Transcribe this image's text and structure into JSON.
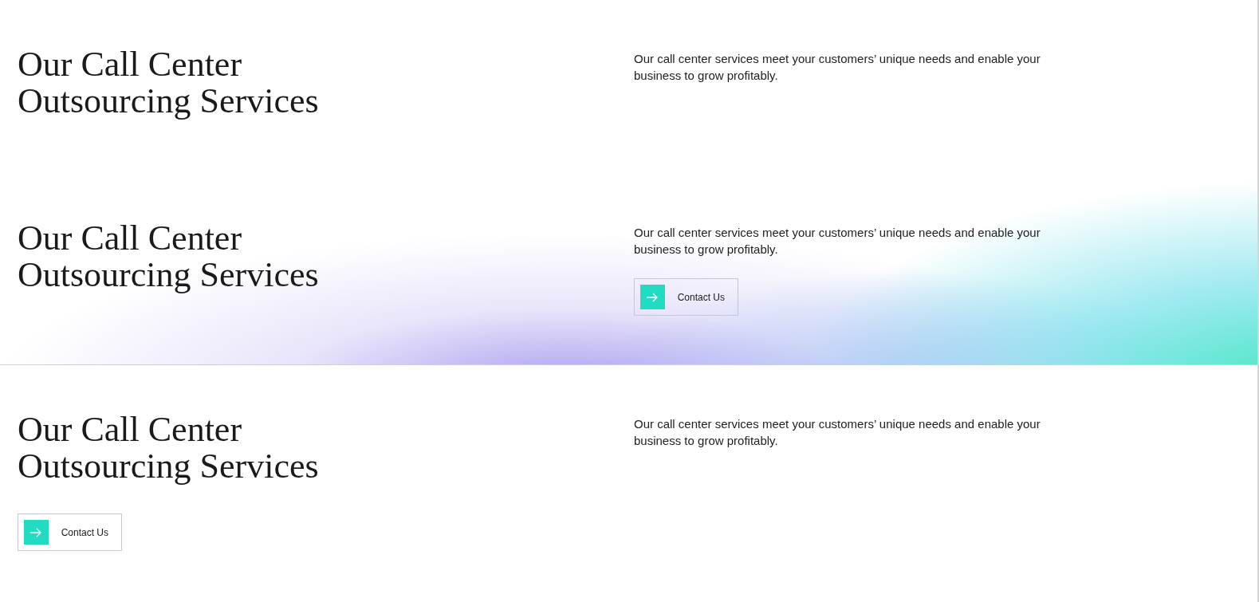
{
  "sections": [
    {
      "kind": "plain",
      "heading": "Our Call Center Outsourcing Services",
      "text": "Our call center services meet your customers’ unique needs and enable your business to grow profitably."
    },
    {
      "kind": "gradient",
      "heading": "Our Call Center Outsourcing Services",
      "text": "Our call center services meet your customers’ unique needs and enable your business to grow profitably.",
      "button": {
        "label": "Contact Us"
      }
    },
    {
      "kind": "stacked",
      "heading": "Our Call Center Outsourcing Services",
      "text": "Our call center services meet your customers’ unique needs and enable your business to grow profitably.",
      "button": {
        "label": "Contact Us"
      }
    }
  ]
}
